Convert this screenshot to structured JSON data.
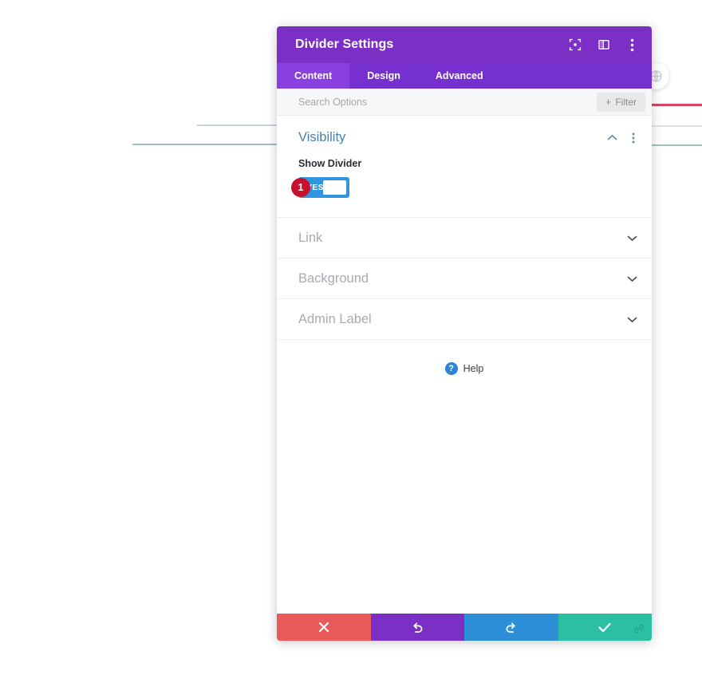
{
  "window": {
    "title": "Divider Settings",
    "titlebar_icons": [
      {
        "name": "focus-icon",
        "label": "Focus"
      },
      {
        "name": "layout-icon",
        "label": "Layout"
      },
      {
        "name": "more-vertical-icon",
        "label": "More options"
      }
    ]
  },
  "tabs": [
    {
      "label": "Content",
      "active": true
    },
    {
      "label": "Design",
      "active": false
    },
    {
      "label": "Advanced",
      "active": false
    }
  ],
  "search": {
    "placeholder": "Search Options",
    "value": "",
    "filter_label": "Filter",
    "filter_plus": "+"
  },
  "sections": {
    "open": {
      "title": "Visibility",
      "collapse_icon": "chevron-up-icon",
      "menu_icon": "more-vertical-icon",
      "field": {
        "label": "Show Divider",
        "toggle_value": "YES",
        "badge": "1"
      }
    },
    "collapsed": [
      {
        "title": "Link",
        "chevron": "chevron-down-icon"
      },
      {
        "title": "Background",
        "chevron": "chevron-down-icon"
      },
      {
        "title": "Admin Label",
        "chevron": "chevron-down-icon"
      }
    ]
  },
  "help": {
    "label": "Help",
    "icon_glyph": "?"
  },
  "footer": {
    "buttons": [
      {
        "name": "cancel-button",
        "icon": "close-icon",
        "color": "#eb5a5a"
      },
      {
        "name": "undo-button",
        "icon": "undo-icon",
        "color": "#7b2fc4"
      },
      {
        "name": "redo-button",
        "icon": "redo-icon",
        "color": "#2e8fd9"
      },
      {
        "name": "save-button",
        "icon": "check-icon",
        "color": "#2bc0a4"
      }
    ],
    "resize_handle_icon": "resize-handle-icon"
  },
  "colors": {
    "titlebar": "#7B2FC4",
    "tabbar": "#7630cf",
    "tab_active": "#8a3fe0",
    "section_title": "#4a7fa8",
    "collapsed_title": "#a9a9b2",
    "toggle_on": "#2e95de",
    "badge": "#c8102e",
    "help_icon": "#2e84d0"
  },
  "background": {
    "divider_lines": [
      {
        "name": "divider-line-gray",
        "color": "#c9d1dc"
      },
      {
        "name": "divider-line-teal",
        "color": "#9fc0c4"
      },
      {
        "name": "divider-line-red",
        "color": "#d9455f"
      }
    ],
    "floating_button_icon": "globe-link-icon"
  }
}
